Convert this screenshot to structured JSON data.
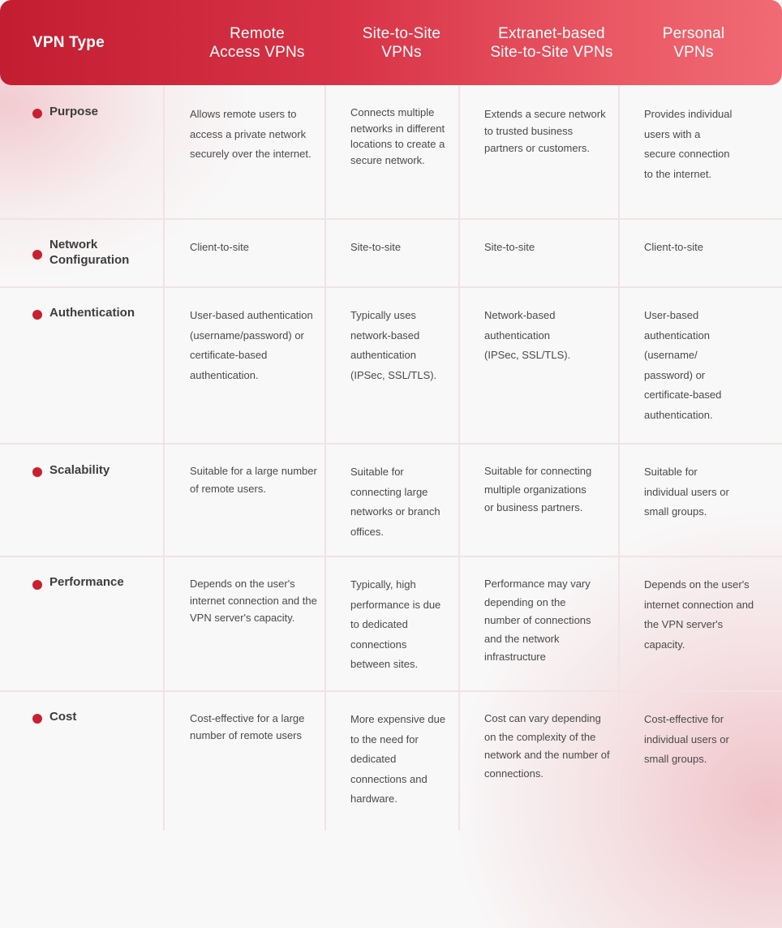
{
  "header": {
    "row_label": "VPN Type",
    "columns": [
      "Remote\nAccess VPNs",
      "Site-to-Site\nVPNs",
      "Extranet-based\nSite-to-Site VPNs",
      "Personal\nVPNs"
    ]
  },
  "colors": {
    "header_gradient_start": "#c21d31",
    "header_gradient_end": "#f06b74",
    "bullet": "#c8202f",
    "gridline": "#f1e3e5",
    "text": "#4a4a4a"
  },
  "rows": [
    {
      "label": "Purpose",
      "cells": [
        "Allows remote users to access a private network securely over the internet.",
        "Connects multiple networks in different locations to create a secure network.",
        "Extends a secure network to trusted business partners or customers.",
        "Provides individual users with a secure connection to the internet."
      ]
    },
    {
      "label": "Network Configuration",
      "cells": [
        "Client-to-site",
        "Site-to-site",
        "Site-to-site",
        "Client-to-site"
      ]
    },
    {
      "label": "Authentication",
      "cells": [
        "User-based authentication (username/password) or certificate-based authentication.",
        "Typically uses network-based authentication (IPSec, SSL/TLS).",
        "Network-based authentication (IPSec, SSL/TLS).",
        "User-based authentication (username/ password) or certificate-based authentication."
      ]
    },
    {
      "label": "Scalability",
      "cells": [
        "Suitable for a large number of remote users.",
        "Suitable for connecting large networks or branch offices.",
        "Suitable for connecting multiple organizations or business partners.",
        "Suitable for individual users or small groups."
      ]
    },
    {
      "label": "Performance",
      "cells": [
        "Depends on the user's internet connection and the VPN server's capacity.",
        "Typically, high performance is due to dedicated connections between sites.",
        "Performance may vary depending on the number of connections and the network infrastructure",
        "Depends on the user's internet connection and the VPN server's capacity."
      ]
    },
    {
      "label": "Cost",
      "cells": [
        "Cost-effective for a large number of remote users",
        "More expensive due to the need for dedicated connections and hardware.",
        "Cost can vary depending on the complexity of the network and the number of connections.",
        "Cost-effective for individual users or small groups."
      ]
    }
  ]
}
